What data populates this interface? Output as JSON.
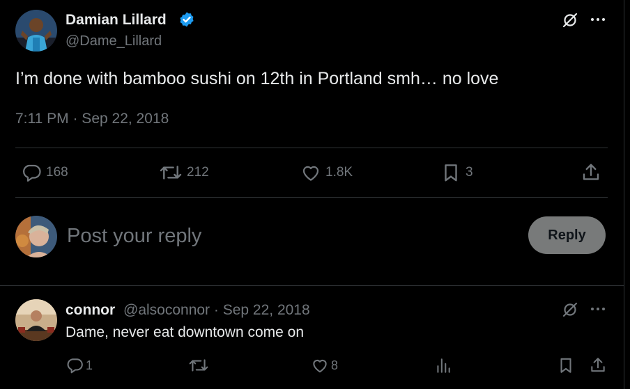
{
  "tweet": {
    "author_name": "Damian Lillard",
    "author_handle": "@Dame_Lillard",
    "text": "I’m done with bamboo sushi on 12th in Portland smh… no love",
    "timestamp": "7:11 PM · Sep 22, 2018",
    "verified": true,
    "accent_color": "#1d9bf0",
    "stats": {
      "replies": "168",
      "reposts": "212",
      "likes": "1.8K",
      "bookmarks": "3"
    }
  },
  "composer": {
    "placeholder": "Post your reply",
    "reply_label": "Reply"
  },
  "reply": {
    "author_name": "connor",
    "meta": "@alsoconnor · Sep 22, 2018",
    "text": "Dame, never eat downtown come on",
    "stats": {
      "replies": "1",
      "likes": "8"
    }
  },
  "icons": [
    "grok-icon",
    "more-icon",
    "reply-icon",
    "repost-icon",
    "like-icon",
    "bookmark-icon",
    "share-icon",
    "views-icon",
    "verified-badge-icon"
  ]
}
